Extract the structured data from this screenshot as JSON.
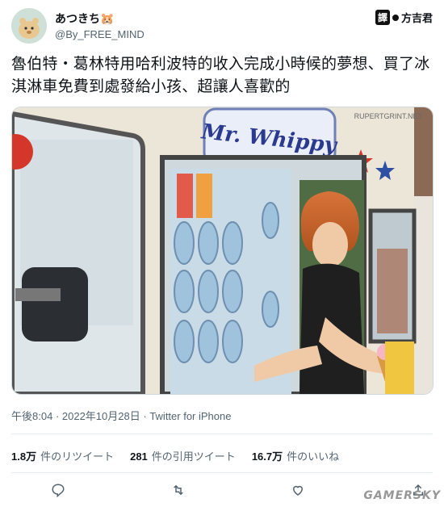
{
  "user": {
    "display_name": "あつきち",
    "emoji": "🐹",
    "handle": "@By_FREE_MIND"
  },
  "translator_badge": {
    "prefix": "譯",
    "name": "方吉君"
  },
  "tweet": {
    "text": "魯伯特・葛林特用哈利波特的收入完成小時候的夢想、買了冰淇淋車免費到處發給小孩、超讓人喜歡的"
  },
  "photo": {
    "sign_text": "Mr. Whippy",
    "credit_text": "RUPERTGRINT.NET"
  },
  "meta": {
    "time": "午後8:04",
    "date": "2022年10月28日",
    "source": "Twitter for iPhone"
  },
  "stats": [
    {
      "count": "1.8万",
      "label": "件のリツイート"
    },
    {
      "count": "281",
      "label": "件の引用ツイート"
    },
    {
      "count": "16.7万",
      "label": "件のいいね"
    }
  ],
  "actions": {
    "reply": "reply-icon",
    "retweet": "retweet-icon",
    "like": "heart-icon",
    "share": "share-icon"
  },
  "watermark": "GAMERSKY",
  "colors": {
    "handle": "#536471",
    "divider": "#e6ecf0",
    "star_red": "#d4372a",
    "star_blue": "#2f4fa2"
  }
}
